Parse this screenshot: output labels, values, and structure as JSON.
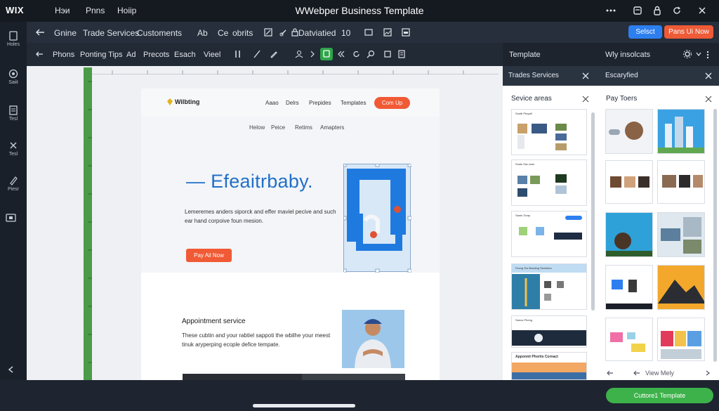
{
  "topbar": {
    "logo": "WIX",
    "menu": [
      "Hэи",
      "Pnns",
      "Hoiip"
    ],
    "title": "WWebper Business Template"
  },
  "toolbar2": {
    "items": [
      "Gnine",
      "Trade Services",
      "Customents"
    ],
    "ab": "Ab",
    "code": "Ce",
    "obrits": "obrits",
    "status": "Datviatied",
    "count": "10",
    "select_label": "Selsct",
    "publish_label": "Pans Ui Now"
  },
  "toolbar3": {
    "items": [
      "Phons",
      "Ponting Tips",
      "Ad",
      "Precots",
      "Esach",
      "Vieel"
    ]
  },
  "rail": {
    "items": [
      "Holes",
      "Saiit",
      "Tesl",
      "Tesl",
      "Piesr"
    ]
  },
  "right_panel": {
    "header1": "Template",
    "header2": "Wly insolcats",
    "sub1": "Trades Services",
    "sub2": "Escaryfied",
    "panel1_title": "Sevice areas",
    "panel2_title": "Pay Toers",
    "view_more": "View Mely",
    "custom_button": "Cuttore1 Template",
    "panel1_thumbs": [
      "Sustb Ptoyaif",
      "Susts Sss cuss",
      "Sants Toray",
      "Fecng Srs Bnading Semtises",
      "Sanos Pheng",
      "Apponmt Phortis Cornact"
    ]
  },
  "site": {
    "logo": "Wilbting",
    "nav": [
      "Aaao",
      "Delrs",
      "Prepides",
      "Templates"
    ],
    "nav_button": "Com Up",
    "subnav": [
      "Helow",
      "Peice",
      "Retims",
      "Amapters"
    ],
    "hero_title": "— Efeaitrbaby.",
    "hero_body": "Lemeremes anders siporck and effer maviel pecive and such ear hand corpoive foun mesion.",
    "hero_button": "Pay Ail Now",
    "appt_title": "Appointment service",
    "appt_body": "These cubtin and your rabtiel sappoti the wbilhe your meest tinuk aryperping ecople defice tempate."
  },
  "colors": {
    "accent_blue": "#2d7ff0",
    "publish_orange": "#ef5a37",
    "green": "#3db24a",
    "dark_bg": "#1e2530"
  }
}
